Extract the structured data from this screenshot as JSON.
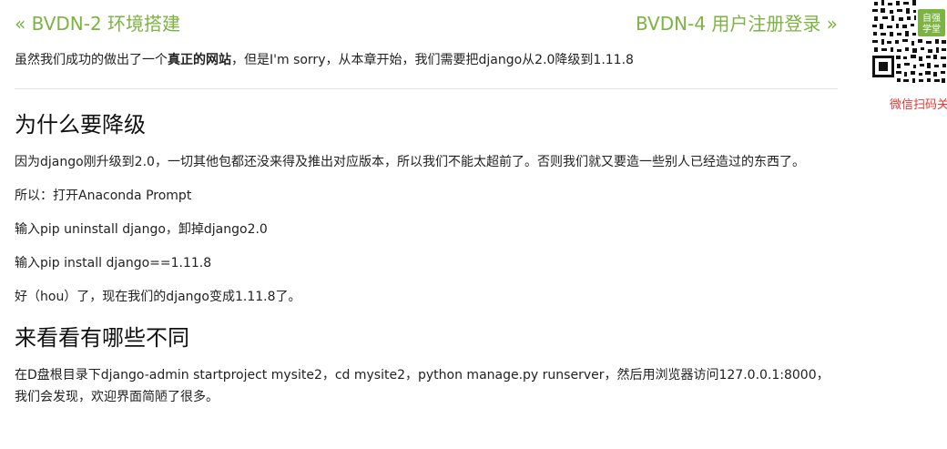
{
  "nav": {
    "prev_label": "« BVDN-2 环境搭建",
    "next_label": "BVDN-4 用户注册登录 »"
  },
  "intro": {
    "before": "虽然我们成功的做出了一个",
    "bold": "真正的网站",
    "after": "，但是I'm sorry，从本章开始，我们需要把django从2.0降级到1.11.8"
  },
  "section_why": {
    "heading": "为什么要降级",
    "paragraphs": [
      "因为django刚升级到2.0，一切其他包都还没来得及推出对应版本，所以我们不能太超前了。否则我们就又要造一些别人已经造过的东西了。",
      "所以：打开Anaconda Prompt",
      "输入pip uninstall django，卸掉django2.0",
      "输入pip install django==1.11.8",
      "好（hou）了，现在我们的django变成1.11.8了。"
    ]
  },
  "section_diff": {
    "heading": "来看看有哪些不同",
    "paragraphs": [
      "在D盘根目录下django-admin startproject mysite2，cd mysite2，python manage.py runserver，然后用浏览器访问127.0.0.1:8000，我们会发现，欢迎界面简陋了很多。"
    ]
  },
  "qr": {
    "badge_line1": "自强",
    "badge_line2": "学堂",
    "caption": "微信扫码关注",
    "badge_color": "#7cb342",
    "caption_color": "#e53935"
  }
}
